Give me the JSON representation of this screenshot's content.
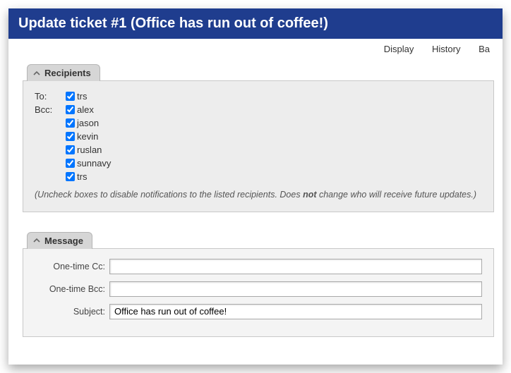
{
  "header": {
    "title": "Update ticket #1 (Office has run out of coffee!)"
  },
  "menu": {
    "display": "Display",
    "history": "History",
    "basics": "Ba"
  },
  "recipients": {
    "tab": "Recipients",
    "to_label": "To:",
    "bcc_label": "Bcc:",
    "to": [
      {
        "name": "trs",
        "checked": true
      }
    ],
    "bcc": [
      {
        "name": "alex",
        "checked": true
      },
      {
        "name": "jason",
        "checked": true
      },
      {
        "name": "kevin",
        "checked": true
      },
      {
        "name": "ruslan",
        "checked": true
      },
      {
        "name": "sunnavy",
        "checked": true
      },
      {
        "name": "trs",
        "checked": true
      }
    ],
    "note_a": "(Uncheck boxes to disable notifications to the listed recipients. Does ",
    "note_b": "not",
    "note_c": " change who will receive future updates.)"
  },
  "message": {
    "tab": "Message",
    "cc_label": "One-time Cc:",
    "bcc_label": "One-time Bcc:",
    "subject_label": "Subject:",
    "cc_value": "",
    "bcc_value": "",
    "subject_value": "Office has run out of coffee!"
  }
}
